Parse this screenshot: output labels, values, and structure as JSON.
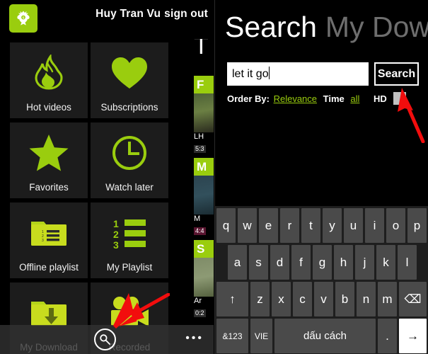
{
  "left": {
    "header": {
      "logo_icon": "app-logo-icon",
      "account_name": "Huy Tran Vu",
      "sign_out": "sign out"
    },
    "tiles": [
      {
        "label": "Hot videos",
        "icon": "flame-icon"
      },
      {
        "label": "Subscriptions",
        "icon": "heart-icon"
      },
      {
        "label": "Favorites",
        "icon": "star-icon"
      },
      {
        "label": "Watch later",
        "icon": "clock-icon"
      },
      {
        "label": "Offline playlist",
        "icon": "folder-list-icon"
      },
      {
        "label": "My Playlist",
        "icon": "numbered-list-icon"
      },
      {
        "label": "My Download",
        "icon": "folder-download-icon"
      },
      {
        "label": "Recorded",
        "icon": "video-camera-icon"
      }
    ],
    "video_strip": {
      "heading": "T",
      "items": [
        {
          "badge": "F",
          "title": "LH",
          "duration": "5:3"
        },
        {
          "badge": "M",
          "title": "M",
          "duration": "4:4"
        },
        {
          "badge": "S",
          "title": "Ar",
          "duration": "0:2"
        }
      ]
    },
    "appbar": {
      "search_icon": "search-icon",
      "more_label": "•••"
    }
  },
  "right": {
    "pivot": {
      "active": "Search",
      "inactive": "My Dow"
    },
    "search": {
      "value": "let it go",
      "placeholder": "",
      "button_label": "Search"
    },
    "order": {
      "label": "Order By:",
      "relevance": "Relevance",
      "time": "Time",
      "all": "all",
      "hd": "HD",
      "hd_checked": false
    },
    "keyboard": {
      "row1": [
        "q",
        "w",
        "e",
        "r",
        "t",
        "y",
        "u",
        "i",
        "o",
        "p"
      ],
      "row2": [
        "a",
        "s",
        "d",
        "f",
        "g",
        "h",
        "j",
        "k",
        "l"
      ],
      "row3": [
        "↑",
        "z",
        "x",
        "c",
        "v",
        "b",
        "n",
        "m",
        "⌫"
      ],
      "row4": [
        "&123",
        "VIE",
        "dấu cách",
        ".",
        "→"
      ]
    }
  },
  "colors": {
    "accent_green": "#9ACD0E",
    "tile_bg": "#1c1c1c",
    "key_bg": "#4a4a4a",
    "arrow_red": "#F20D0D",
    "background": "#000000"
  }
}
